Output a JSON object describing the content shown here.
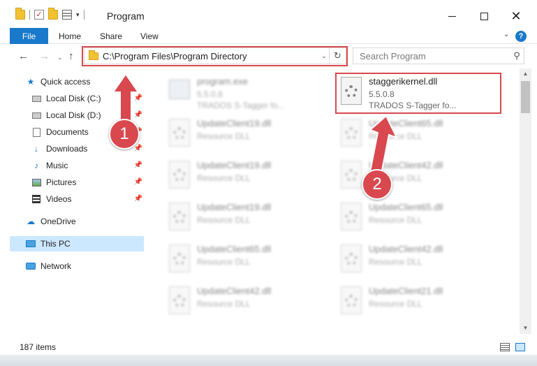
{
  "window": {
    "title": "Program",
    "minimize_glyph": "",
    "close_glyph": "✕"
  },
  "quick_access_toolbar": {
    "check_glyph": "✓",
    "dropdown_glyph": "▾"
  },
  "ribbon": {
    "tabs": [
      {
        "label": "File"
      },
      {
        "label": "Home"
      },
      {
        "label": "Share"
      },
      {
        "label": "View"
      }
    ],
    "collapse_glyph": "⌄",
    "help_glyph": "?"
  },
  "navigation": {
    "back_glyph": "←",
    "forward_glyph": "→",
    "recent_glyph": "⌄",
    "up_glyph": "↑",
    "address_path": "C:\\Program Files\\Program Directory",
    "address_dropdown_glyph": "⌄",
    "refresh_glyph": "↻",
    "search_placeholder": "Search Program",
    "search_glyph": "⚲"
  },
  "sidebar": {
    "pin_glyph": "📌",
    "items": [
      {
        "label": "Quick access",
        "icon": "star-icon",
        "glyph": "★"
      },
      {
        "label": "Local Disk (C:)",
        "icon": "drive-icon",
        "pinned": true
      },
      {
        "label": "Local Disk (D:)",
        "icon": "drive-icon",
        "pinned": true
      },
      {
        "label": "Documents",
        "icon": "documents-icon",
        "pinned": true
      },
      {
        "label": "Downloads",
        "icon": "download-icon",
        "glyph": "↓",
        "pinned": true
      },
      {
        "label": "Music",
        "icon": "music-icon",
        "glyph": "♪",
        "pinned": true
      },
      {
        "label": "Pictures",
        "icon": "pictures-icon",
        "pinned": true
      },
      {
        "label": "Videos",
        "icon": "videos-icon",
        "pinned": true
      },
      {
        "label": "OneDrive",
        "icon": "cloud-icon",
        "glyph": "☁"
      },
      {
        "label": "This PC",
        "icon": "computer-icon",
        "selected": true
      },
      {
        "label": "Network",
        "icon": "network-icon"
      }
    ]
  },
  "files": [
    {
      "name": "program.exe",
      "line1": "5.5.0.8",
      "line2": "TRADOS S-Tagger fo...",
      "icon": "exe-icon",
      "blurred": true
    },
    {
      "name": "staggerikernel.dll",
      "line1": "5.5.0.8",
      "line2": "TRADOS S-Tagger  fo...",
      "icon": "dll-icon",
      "blurred": false
    },
    {
      "name": "UpdateClient19.dll",
      "line1": "Resource DLL",
      "icon": "dll-icon",
      "blurred": true
    },
    {
      "name": "UpdateClient65.dll",
      "line1": "Resource DLL",
      "icon": "dll-icon",
      "blurred": true
    },
    {
      "name": "UpdateClient19.dll",
      "line1": "Resource DLL",
      "icon": "dll-icon",
      "blurred": true
    },
    {
      "name": "UpdateClient42.dll",
      "line1": "Resource DLL",
      "icon": "dll-icon",
      "blurred": true
    },
    {
      "name": "UpdateClient19.dll",
      "line1": "Resource DLL",
      "icon": "dll-icon",
      "blurred": true
    },
    {
      "name": "UpdateClient65.dll",
      "line1": "Resource DLL",
      "icon": "dll-icon",
      "blurred": true
    },
    {
      "name": "UpdateClient65.dll",
      "line1": "Resource DLL",
      "icon": "dll-icon",
      "blurred": true
    },
    {
      "name": "UpdateClient42.dll",
      "line1": "Resource DLL",
      "icon": "dll-icon",
      "blurred": true
    },
    {
      "name": "UpdateClient42.dll",
      "line1": "Resource DLL",
      "icon": "dll-icon",
      "blurred": true
    },
    {
      "name": "UpdateClient21.dll",
      "line1": "Resource DLL",
      "icon": "dll-icon",
      "blurred": true
    }
  ],
  "scrollbar": {
    "up_glyph": "▲",
    "down_glyph": "▼"
  },
  "status": {
    "item_count": "187 items"
  },
  "annotations": {
    "callouts": [
      {
        "label": "1"
      },
      {
        "label": "2"
      }
    ],
    "color": "#d9484e"
  }
}
